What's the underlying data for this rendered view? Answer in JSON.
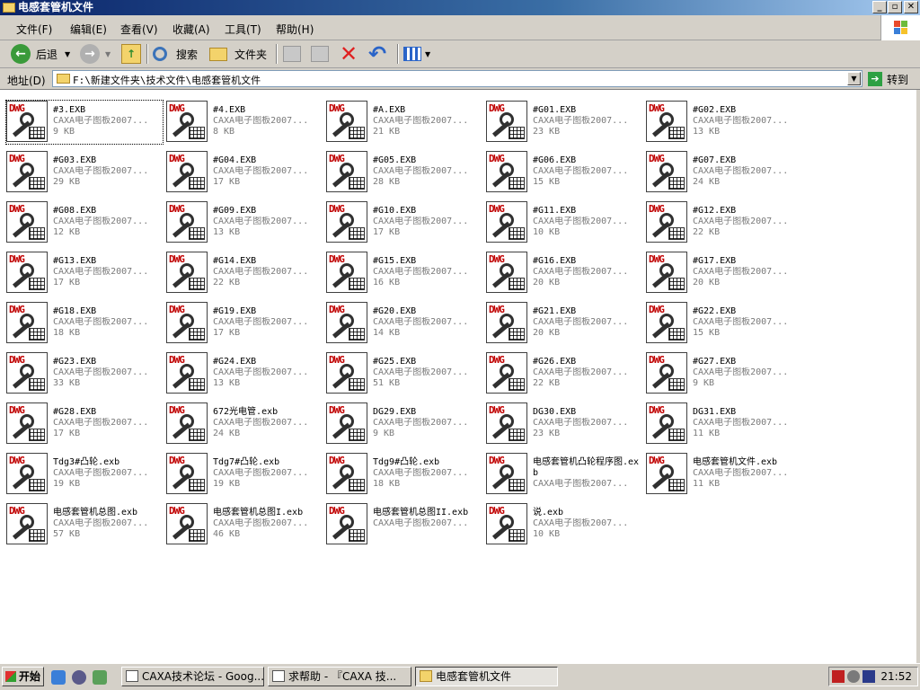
{
  "window": {
    "title": "电感套管机文件"
  },
  "menu": [
    "文件(F)",
    "编辑(E)",
    "查看(V)",
    "收藏(A)",
    "工具(T)",
    "帮助(H)"
  ],
  "toolbar": {
    "back": "后退",
    "search": "搜索",
    "folders": "文件夹"
  },
  "address": {
    "label": "地址(D)",
    "path": "F:\\新建文件夹\\技术文件\\电感套管机文件",
    "go": "转到"
  },
  "files": [
    {
      "name": "#3.EXB",
      "type": "CAXA电子图板2007...",
      "size": "9 KB"
    },
    {
      "name": "#4.EXB",
      "type": "CAXA电子图板2007...",
      "size": "8 KB"
    },
    {
      "name": "#A.EXB",
      "type": "CAXA电子图板2007...",
      "size": "21 KB"
    },
    {
      "name": "#G01.EXB",
      "type": "CAXA电子图板2007...",
      "size": "23 KB"
    },
    {
      "name": "#G02.EXB",
      "type": "CAXA电子图板2007...",
      "size": "13 KB"
    },
    {
      "name": "#G03.EXB",
      "type": "CAXA电子图板2007...",
      "size": "29 KB"
    },
    {
      "name": "#G04.EXB",
      "type": "CAXA电子图板2007...",
      "size": "17 KB"
    },
    {
      "name": "#G05.EXB",
      "type": "CAXA电子图板2007...",
      "size": "28 KB"
    },
    {
      "name": "#G06.EXB",
      "type": "CAXA电子图板2007...",
      "size": "15 KB"
    },
    {
      "name": "#G07.EXB",
      "type": "CAXA电子图板2007...",
      "size": "24 KB"
    },
    {
      "name": "#G08.EXB",
      "type": "CAXA电子图板2007...",
      "size": "12 KB"
    },
    {
      "name": "#G09.EXB",
      "type": "CAXA电子图板2007...",
      "size": "13 KB"
    },
    {
      "name": "#G10.EXB",
      "type": "CAXA电子图板2007...",
      "size": "17 KB"
    },
    {
      "name": "#G11.EXB",
      "type": "CAXA电子图板2007...",
      "size": "10 KB"
    },
    {
      "name": "#G12.EXB",
      "type": "CAXA电子图板2007...",
      "size": "22 KB"
    },
    {
      "name": "#G13.EXB",
      "type": "CAXA电子图板2007...",
      "size": "17 KB"
    },
    {
      "name": "#G14.EXB",
      "type": "CAXA电子图板2007...",
      "size": "22 KB"
    },
    {
      "name": "#G15.EXB",
      "type": "CAXA电子图板2007...",
      "size": "16 KB"
    },
    {
      "name": "#G16.EXB",
      "type": "CAXA电子图板2007...",
      "size": "20 KB"
    },
    {
      "name": "#G17.EXB",
      "type": "CAXA电子图板2007...",
      "size": "20 KB"
    },
    {
      "name": "#G18.EXB",
      "type": "CAXA电子图板2007...",
      "size": "18 KB"
    },
    {
      "name": "#G19.EXB",
      "type": "CAXA电子图板2007...",
      "size": "17 KB"
    },
    {
      "name": "#G20.EXB",
      "type": "CAXA电子图板2007...",
      "size": "14 KB"
    },
    {
      "name": "#G21.EXB",
      "type": "CAXA电子图板2007...",
      "size": "20 KB"
    },
    {
      "name": "#G22.EXB",
      "type": "CAXA电子图板2007...",
      "size": "15 KB"
    },
    {
      "name": "#G23.EXB",
      "type": "CAXA电子图板2007...",
      "size": "33 KB"
    },
    {
      "name": "#G24.EXB",
      "type": "CAXA电子图板2007...",
      "size": "13 KB"
    },
    {
      "name": "#G25.EXB",
      "type": "CAXA电子图板2007...",
      "size": "51 KB"
    },
    {
      "name": "#G26.EXB",
      "type": "CAXA电子图板2007...",
      "size": "22 KB"
    },
    {
      "name": "#G27.EXB",
      "type": "CAXA电子图板2007...",
      "size": "9 KB"
    },
    {
      "name": "#G28.EXB",
      "type": "CAXA电子图板2007...",
      "size": "17 KB"
    },
    {
      "name": "672光电管.exb",
      "type": "CAXA电子图板2007...",
      "size": "24 KB"
    },
    {
      "name": "DG29.EXB",
      "type": "CAXA电子图板2007...",
      "size": "9 KB"
    },
    {
      "name": "DG30.EXB",
      "type": "CAXA电子图板2007...",
      "size": "23 KB"
    },
    {
      "name": "DG31.EXB",
      "type": "CAXA电子图板2007...",
      "size": "11 KB"
    },
    {
      "name": "Tdg3#凸轮.exb",
      "type": "CAXA电子图板2007...",
      "size": "19 KB"
    },
    {
      "name": "Tdg7#凸轮.exb",
      "type": "CAXA电子图板2007...",
      "size": "19 KB"
    },
    {
      "name": "Tdg9#凸轮.exb",
      "type": "CAXA电子图板2007...",
      "size": "18 KB"
    },
    {
      "name": "电感套管机凸轮程序图.exb",
      "type": "CAXA电子图板2007...",
      "size": ""
    },
    {
      "name": "电感套管机文件.exb",
      "type": "CAXA电子图板2007...",
      "size": "11 KB"
    },
    {
      "name": "电感套管机总图.exb",
      "type": "CAXA电子图板2007...",
      "size": "57 KB"
    },
    {
      "name": "电感套管机总图I.exb",
      "type": "CAXA电子图板2007...",
      "size": "46 KB"
    },
    {
      "name": "电感套管机总图II.exb",
      "type": "CAXA电子图板2007...",
      "size": ""
    },
    {
      "name": "说.exb",
      "type": "CAXA电子图板2007...",
      "size": "10 KB"
    }
  ],
  "taskbar": {
    "start": "开始",
    "tasks": [
      {
        "label": "CAXA技术论坛 - Goog..."
      },
      {
        "label": "求帮助 - 『CAXA 技..."
      },
      {
        "label": "电感套管机文件"
      }
    ],
    "clock": "21:52"
  }
}
